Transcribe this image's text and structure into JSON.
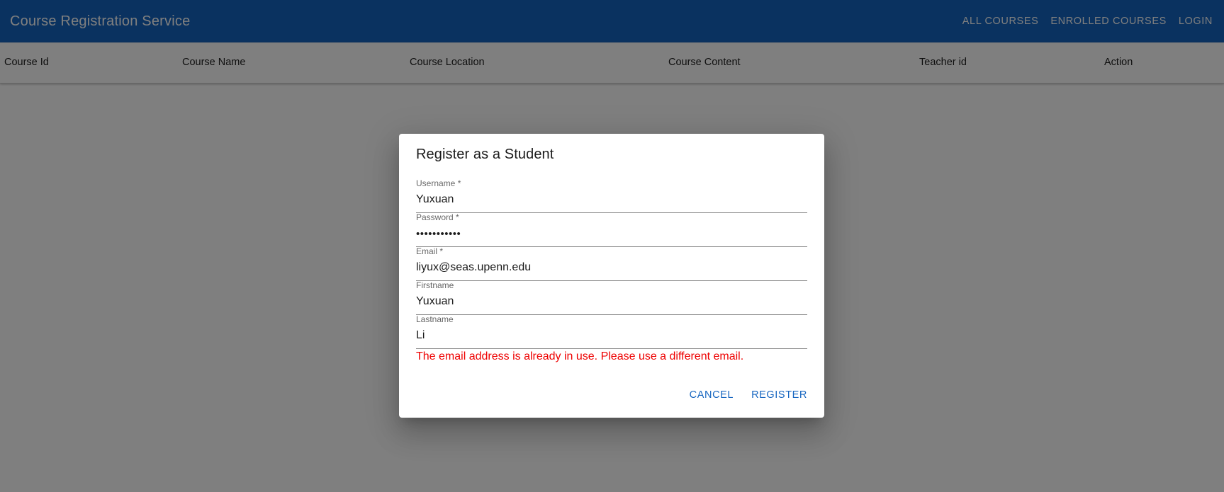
{
  "app": {
    "title": "Course Registration Service",
    "nav": [
      {
        "label": "ALL COURSES"
      },
      {
        "label": "ENROLLED COURSES"
      },
      {
        "label": "LOGIN"
      }
    ]
  },
  "table": {
    "headers": [
      "Course Id",
      "Course Name",
      "Course Location",
      "Course Content",
      "Teacher id",
      "Action"
    ]
  },
  "dialog": {
    "title": "Register as a Student",
    "fields": [
      {
        "label": "Username *",
        "value": "Yuxuan"
      },
      {
        "label": "Password *",
        "value": "•••••••••••"
      },
      {
        "label": "Email *",
        "value": "liyux@seas.upenn.edu"
      },
      {
        "label": "Firstname",
        "value": "Yuxuan"
      },
      {
        "label": "Lastname",
        "value": "Li"
      }
    ],
    "error": "The email address is already in use. Please use a different email.",
    "cancel_label": "CANCEL",
    "register_label": "REGISTER"
  },
  "colors": {
    "primary": "#1565c0",
    "error": "#ee0000",
    "backdrop": "rgba(0,0,0,0.5)"
  }
}
